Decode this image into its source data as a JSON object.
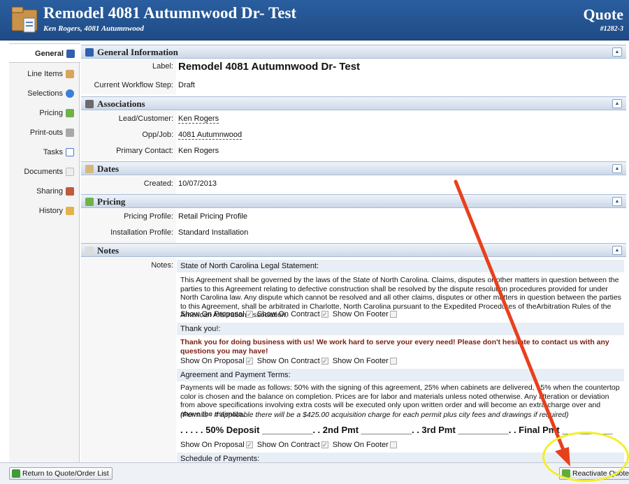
{
  "header": {
    "title": "Remodel 4081 Autumnwood Dr- Test",
    "subtitle": "Ken Rogers, 4081 Autumnwood",
    "doc_type": "Quote",
    "doc_number": "#1282-3"
  },
  "sidebar": {
    "items": [
      {
        "label": "General",
        "icon": "info-icon"
      },
      {
        "label": "Line Items",
        "icon": "line-items-icon"
      },
      {
        "label": "Selections",
        "icon": "selections-icon"
      },
      {
        "label": "Pricing",
        "icon": "pricing-icon"
      },
      {
        "label": "Print-outs",
        "icon": "printouts-icon"
      },
      {
        "label": "Tasks",
        "icon": "tasks-icon"
      },
      {
        "label": "Documents",
        "icon": "documents-icon"
      },
      {
        "label": "Sharing",
        "icon": "sharing-icon"
      },
      {
        "label": "History",
        "icon": "history-icon"
      }
    ]
  },
  "general": {
    "title": "General Information",
    "label_label": "Label:",
    "label_value": "Remodel 4081 Autumnwood Dr- Test",
    "workflow_label": "Current Workflow Step:",
    "workflow_value": "Draft"
  },
  "associations": {
    "title": "Associations",
    "customer_label": "Lead/Customer:",
    "customer_value": "Ken Rogers",
    "job_label": "Opp/Job:",
    "job_value": "4081 Autumnwood",
    "contact_label": "Primary Contact:",
    "contact_value": "Ken Rogers"
  },
  "dates": {
    "title": "Dates",
    "created_label": "Created:",
    "created_value": "10/07/2013"
  },
  "pricing": {
    "title": "Pricing",
    "profile_label": "Pricing Profile:",
    "profile_value": "Retail Pricing Profile",
    "install_label": "Installation Profile:",
    "install_value": "Standard Installation"
  },
  "notes": {
    "title": "Notes",
    "notes_label": "Notes:",
    "show_proposal": "Show On Proposal",
    "show_contract": "Show On Contract",
    "show_footer": "Show On Footer",
    "n1_title": "State of North Carolina Legal Statement:",
    "n1_body": "This Agreement shall be governed by the laws of the State of North Carolina. Claims, disputes or other matters in question between the parties to this Agreement relating to defective construction shall be resolved by the dispute resolution procedures provided for under North Carolina law. Any dispute which cannot be resolved and all other claims, disputes or other matters in question between the parties to this Agreement, shall be arbitrated in Charlotte, North Carolina pursuant to the Expedited Procedures of theArbitration Rules of the American Arbitration Association.",
    "n2_title": "Thank you!:",
    "n2_body": "Thank you for doing business with us! We work hard to serve your every need! Please don't hesitate to contact us with any questions you may have!",
    "n3_title": "Agreement and Payment Terms:",
    "n3_body": "Payments will be made as follows: 50% with the signing of this agreement, 25% when cabinets are delivered, 15% when the countertop color is chosen and the balance on completion. Prices are for labor and materials unless noted otherwise. Any alteration or deviation from above specifications involving extra costs will be executed only upon written order and will become an extra charge over and above the estimate.",
    "n3_permits": "(Permits - If applicable there will be a $425.00 acquisition charge for each permit plus city fees and drawings if required)",
    "n3_deposit": ". . . . . 50% Deposit __________. . 2nd Pmt __________. . 3rd Pmt __________. . Final Pmt __________",
    "n4_title": "Schedule of Payments:"
  },
  "footer": {
    "return_label": "Return to Quote/Order List",
    "reactivate_label": "Reactivate Quote"
  },
  "colors": {
    "header_bg": "#1f4b86",
    "section_bg": "#cbd8e8",
    "annotation_arrow": "#e8401c",
    "annotation_circle": "#f2ef2a"
  }
}
